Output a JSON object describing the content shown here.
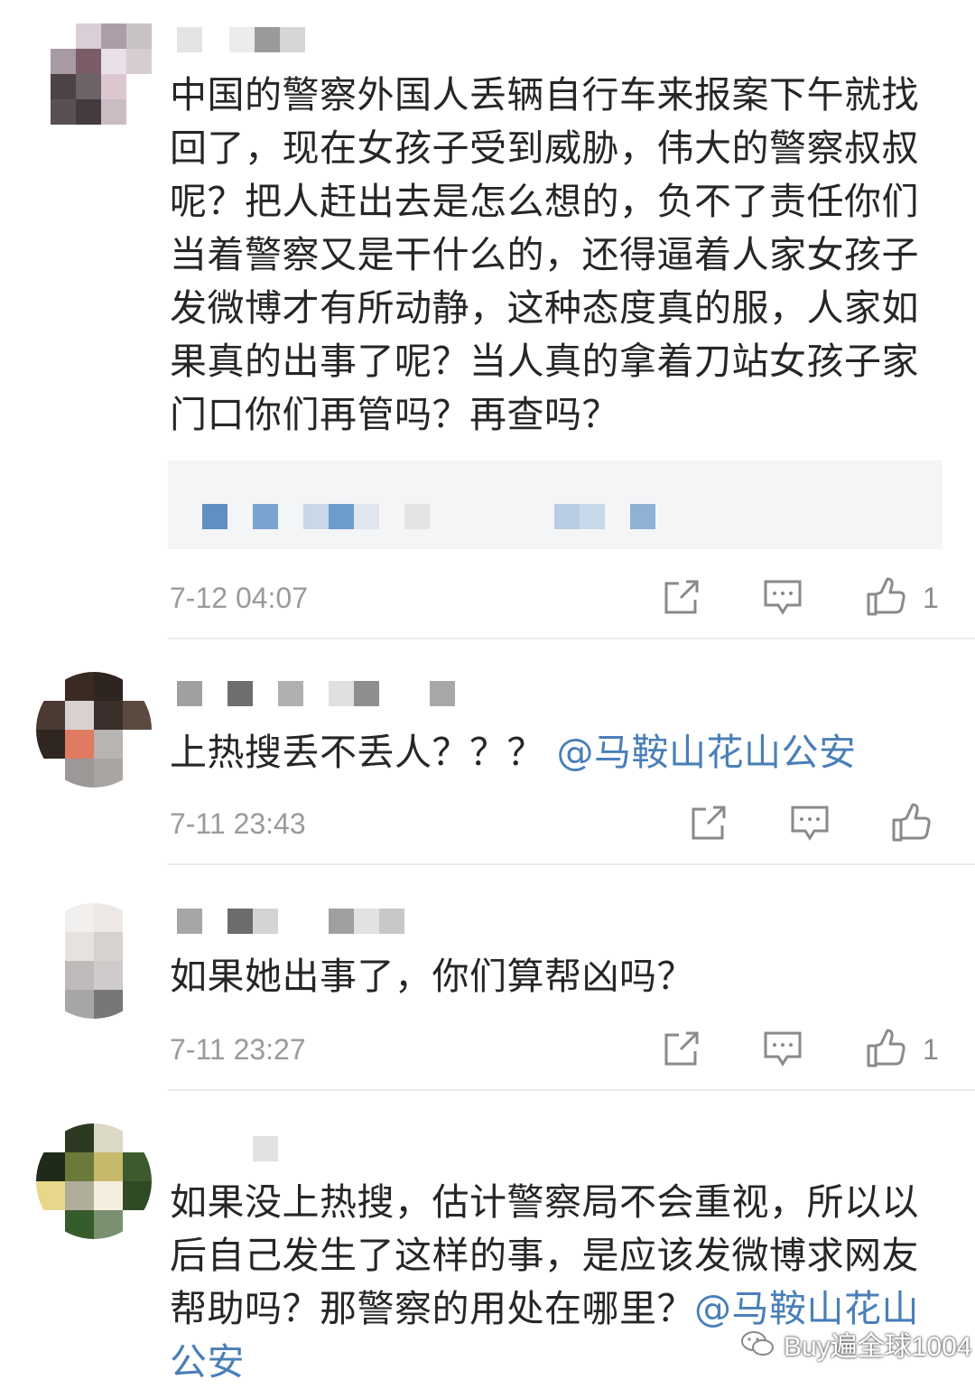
{
  "comments": [
    {
      "text": "中国的警察外国人丢辆自行车来报案下午就找回了，现在女孩子受到威胁，伟大的警察叔叔呢？把人赶出去是怎么想的，负不了责任你们当着警察又是干什么的，还得逼着人家女孩子发微博才有所动静，这种态度真的服，人家如果真的出事了呢？当人真的拿着刀站女孩子家门口你们再管吗？再查吗？",
      "time": "7-12 04:07",
      "likes": "1"
    },
    {
      "text": "上热搜丢不丢人？？？",
      "mention": "@马鞍山花山公安",
      "time": "7-11 23:43",
      "likes": ""
    },
    {
      "text": "如果她出事了，你们算帮凶吗？",
      "time": "7-11 23:27",
      "likes": "1"
    },
    {
      "text": "如果没上热搜，估计警察局不会重视，所以以后自己发生了这样的事，是应该发微博求网友帮助吗？那警察的用处在哪里？",
      "mention": "@马鞍山花山公安",
      "time": "",
      "likes": ""
    }
  ],
  "watermark": "Buy遍全球1004",
  "icons": {
    "repost": "share-icon",
    "comment": "comment-icon",
    "like": "thumbs-up-icon",
    "watermark": "wechat-icon"
  },
  "colors": {
    "text": "#262626",
    "mention": "#4a7fb8",
    "meta": "#9a9a9a"
  }
}
